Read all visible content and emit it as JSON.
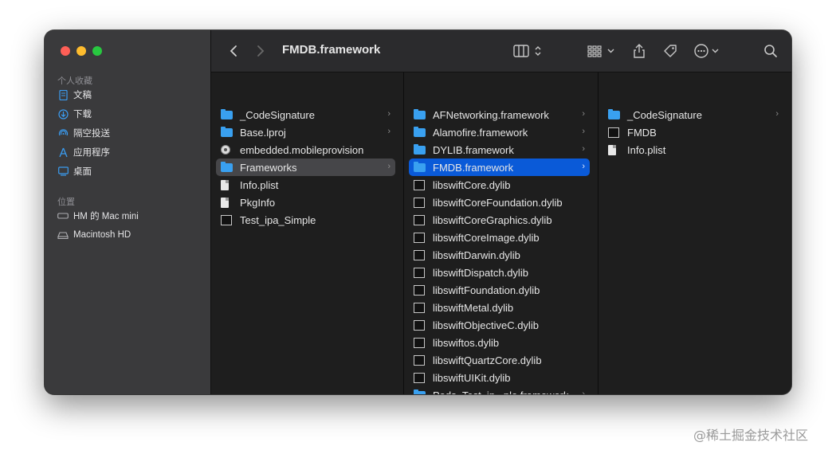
{
  "window": {
    "title": "FMDB.framework"
  },
  "sidebar": {
    "sections": [
      {
        "label": "个人收藏",
        "items": [
          {
            "label": "文稿",
            "icon": "document-icon"
          },
          {
            "label": "下载",
            "icon": "download-icon"
          },
          {
            "label": "隔空投送",
            "icon": "airdrop-icon"
          },
          {
            "label": "应用程序",
            "icon": "applications-icon"
          },
          {
            "label": "桌面",
            "icon": "desktop-icon"
          }
        ]
      },
      {
        "label": "位置",
        "items": [
          {
            "label": "HM 的 Mac mini",
            "icon": "computer-icon"
          },
          {
            "label": "Macintosh HD",
            "icon": "disk-icon"
          }
        ]
      }
    ]
  },
  "columns": [
    {
      "items": [
        {
          "name": "_CodeSignature",
          "type": "folder",
          "chevron": true
        },
        {
          "name": "Base.lproj",
          "type": "folder",
          "chevron": true
        },
        {
          "name": "embedded.mobileprovision",
          "type": "provision"
        },
        {
          "name": "Frameworks",
          "type": "folder",
          "chevron": true,
          "selected": "gray"
        },
        {
          "name": "Info.plist",
          "type": "document"
        },
        {
          "name": "PkgInfo",
          "type": "document"
        },
        {
          "name": "Test_ipa_Simple",
          "type": "exec"
        }
      ]
    },
    {
      "items": [
        {
          "name": "AFNetworking.framework",
          "type": "folder",
          "chevron": true
        },
        {
          "name": "Alamofire.framework",
          "type": "folder",
          "chevron": true
        },
        {
          "name": "DYLIB.framework",
          "type": "folder",
          "chevron": true
        },
        {
          "name": "FMDB.framework",
          "type": "folder",
          "chevron": true,
          "selected": "blue"
        },
        {
          "name": "libswiftCore.dylib",
          "type": "exec"
        },
        {
          "name": "libswiftCoreFoundation.dylib",
          "type": "exec"
        },
        {
          "name": "libswiftCoreGraphics.dylib",
          "type": "exec"
        },
        {
          "name": "libswiftCoreImage.dylib",
          "type": "exec"
        },
        {
          "name": "libswiftDarwin.dylib",
          "type": "exec"
        },
        {
          "name": "libswiftDispatch.dylib",
          "type": "exec"
        },
        {
          "name": "libswiftFoundation.dylib",
          "type": "exec"
        },
        {
          "name": "libswiftMetal.dylib",
          "type": "exec"
        },
        {
          "name": "libswiftObjectiveC.dylib",
          "type": "exec"
        },
        {
          "name": "libswiftos.dylib",
          "type": "exec"
        },
        {
          "name": "libswiftQuartzCore.dylib",
          "type": "exec"
        },
        {
          "name": "libswiftUIKit.dylib",
          "type": "exec"
        },
        {
          "name": "Pods_Test_ip...ple.framework",
          "type": "folder",
          "chevron": true
        }
      ]
    },
    {
      "items": [
        {
          "name": "_CodeSignature",
          "type": "folder",
          "chevron": true
        },
        {
          "name": "FMDB",
          "type": "exec"
        },
        {
          "name": "Info.plist",
          "type": "document"
        }
      ]
    }
  ],
  "watermark": "@稀土掘金技术社区"
}
